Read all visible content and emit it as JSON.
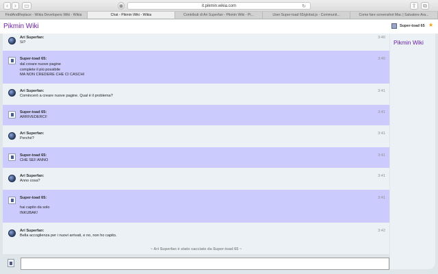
{
  "browser": {
    "url": "it.pikmin.wikia.com",
    "tabs": [
      "FindAndReplace - Wikia Developers Wiki - Wikia",
      "Chat - Pikmin Wiki - Wikia",
      "Contributi di Ari Superfan - Pikmin Wiki - Pi...",
      "User:Super-toad 65/global.js - Communit...",
      "Come fare screenshot Mac | Salvatore Ara..."
    ]
  },
  "header": {
    "wiki_title": "Pikmin Wiki",
    "user_name": "Super-toad 65"
  },
  "messages": [
    {
      "user": "Ari Superfan:",
      "text": "Sì?",
      "time": "3:40",
      "highlight": false,
      "avatar": "globe"
    },
    {
      "user": "Super-toad 65:",
      "text": "dal creare nuove pagine\ncomplete il più possibile\nMA NON CREDERE CHE CI CASCHI",
      "time": "3:40",
      "highlight": true,
      "avatar": "toad"
    },
    {
      "user": "Ari Superfan:",
      "text": "Comincerò a creare nuove pagine. Qual è il problema?",
      "time": "3:41",
      "highlight": false,
      "avatar": "globe"
    },
    {
      "user": "Super-toad 65:",
      "text": "ARRIVEDERCI!",
      "time": "3:41",
      "highlight": true,
      "avatar": "toad"
    },
    {
      "user": "Ari Superfan:",
      "text": "Perché?",
      "time": "3:41",
      "highlight": false,
      "avatar": "globe"
    },
    {
      "user": "Super-toad 65:",
      "text": "CHE SEI! ANNO",
      "time": "3:41",
      "highlight": true,
      "avatar": "toad"
    },
    {
      "user": "Ari Superfan:",
      "text": "Anno cosa?",
      "time": "3:41",
      "highlight": false,
      "avatar": "globe"
    },
    {
      "user": "Super-toad 65:",
      "text": "hai capito da solo\nINKUBAK!",
      "time": "3:41",
      "highlight": true,
      "avatar": "toad"
    },
    {
      "user": "Ari Superfan:",
      "text": "Bella accoglienza per i nuovi arrivati, e no, non ho capito.",
      "time": "3:42",
      "highlight": false,
      "avatar": "globe"
    }
  ],
  "system_message": "~ Ari Superfan è stato cacciato da Super-toad 65 ~",
  "rail": {
    "title": "Pikmin Wiki"
  },
  "input": {
    "value": ""
  }
}
